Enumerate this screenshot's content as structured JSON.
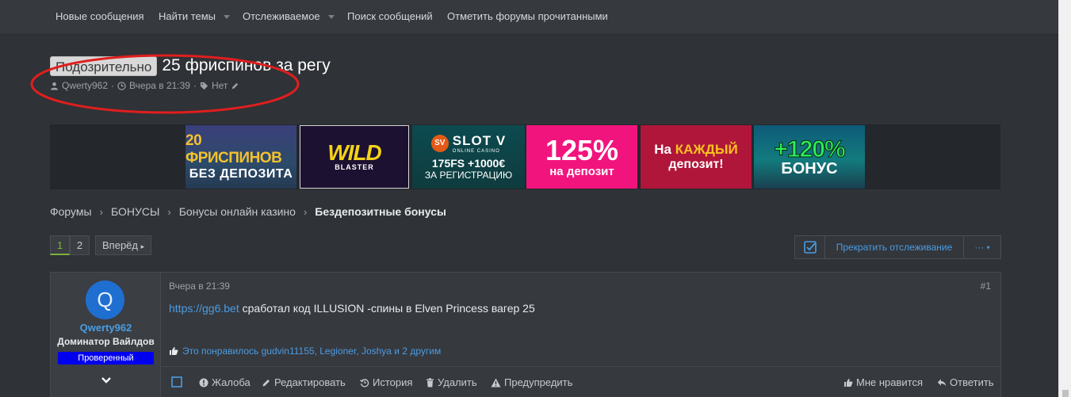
{
  "nav": {
    "items": [
      {
        "label": "Новые сообщения",
        "dropdown": false
      },
      {
        "label": "Найти темы",
        "dropdown": true
      },
      {
        "label": "Отслеживаемое",
        "dropdown": true
      },
      {
        "label": "Поиск сообщений",
        "dropdown": false
      },
      {
        "label": "Отметить форумы прочитанными",
        "dropdown": false
      }
    ]
  },
  "thread": {
    "prefix": "Подозрительно",
    "title": "25 фриспинов за регу",
    "author": "Qwerty962",
    "date": "Вчера в 21:39",
    "tags": "Нет"
  },
  "annotation": {
    "color": "#e01e1e",
    "shape": "ellipse"
  },
  "banners": [
    {
      "line1": "20 ФРИСПИНОВ",
      "line2": "БЕЗ ДЕПОЗИТА"
    },
    {
      "line1": "WILD",
      "line2": "BLASTER"
    },
    {
      "logo": "SV",
      "line1": "SLOT V",
      "sub": "ONLINE CASINO",
      "line2": "175FS +1000€",
      "line3": "ЗА РЕГИСТРАЦИЮ"
    },
    {
      "line1": "125%",
      "line2": "на депозит"
    },
    {
      "line1a": "На ",
      "line1b": "КАЖДЫЙ",
      "line2": "депозит!"
    },
    {
      "line1": "+120%",
      "line2": "БОНУС"
    }
  ],
  "breadcrumb": [
    "Форумы",
    "БОНУСЫ",
    "Бонусы онлайн казино",
    "Бездепозитные бонусы"
  ],
  "pagination": {
    "pages": [
      "1",
      "2"
    ],
    "current": "1",
    "next_label": "Вперёд"
  },
  "watch": {
    "label": "Прекратить отслеживание",
    "more": "···"
  },
  "post": {
    "date": "Вчера в 21:39",
    "number": "#1",
    "link": "https://gg6.bet",
    "text": " сработал код ILLUSION -спины в Elven Princess вагер 25",
    "likes": "Это понравилось gudvin11155, Legioner, Joshya и 2 другим",
    "user": {
      "avatar_letter": "Q",
      "name": "Qwerty962",
      "title": "Доминатор Вайлдов",
      "badge": "Проверенный"
    },
    "actions": {
      "report": "Жалоба",
      "edit": "Редактировать",
      "history": "История",
      "delete": "Удалить",
      "warn": "Предупредить",
      "like": "Мне нравится",
      "reply": "Ответить"
    }
  },
  "colors": {
    "accent": "#4b9ce2",
    "verified": "#0000ee",
    "avatar": "#1f6fd0",
    "page_active": "#79b53b"
  }
}
